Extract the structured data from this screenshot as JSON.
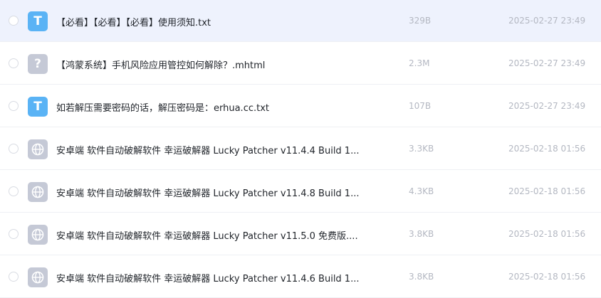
{
  "files": [
    {
      "icon": "txt-file-icon",
      "icon_glyph": "T",
      "name": "【必看】【必看】【必看】使用须知.txt",
      "size": "329B",
      "date": "2025-02-27 23:49"
    },
    {
      "icon": "unknown-file-icon",
      "icon_glyph": "?",
      "name": "【鸿蒙系统】手机风险应用管控如何解除？.mhtml",
      "size": "2.3M",
      "date": "2025-02-27 23:49"
    },
    {
      "icon": "txt-file-icon",
      "icon_glyph": "T",
      "name": "如若解压需要密码的话，解压密码是：erhua.cc.txt",
      "size": "107B",
      "date": "2025-02-27 23:49"
    },
    {
      "icon": "web-file-icon",
      "name": "安卓端 软件自动破解软件 幸运破解器 Lucky Patcher v11.4.4 Build 1...",
      "size": "3.3KB",
      "date": "2025-02-18 01:56"
    },
    {
      "icon": "web-file-icon",
      "name": "安卓端 软件自动破解软件 幸运破解器 Lucky Patcher v11.4.8 Build 1...",
      "size": "4.3KB",
      "date": "2025-02-18 01:56"
    },
    {
      "icon": "web-file-icon",
      "name": "安卓端 软件自动破解软件 幸运破解器 Lucky Patcher v11.5.0 免费版....",
      "size": "3.8KB",
      "date": "2025-02-18 01:56"
    },
    {
      "icon": "web-file-icon",
      "name": "安卓端 软件自动破解软件 幸运破解器 Lucky Patcher v11.4.6 Build 1...",
      "size": "3.8KB",
      "date": "2025-02-18 01:56"
    }
  ]
}
